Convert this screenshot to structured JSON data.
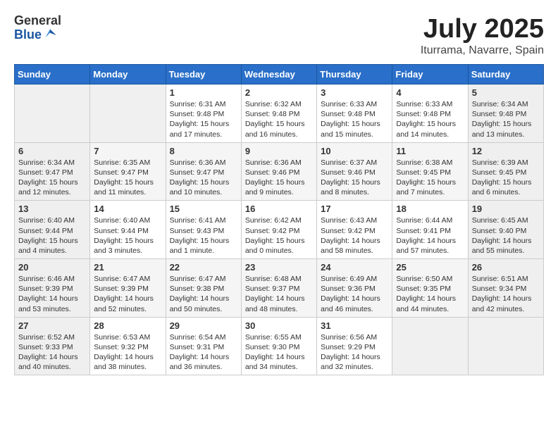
{
  "logo": {
    "general": "General",
    "blue": "Blue"
  },
  "title": "July 2025",
  "location": "Iturrama, Navarre, Spain",
  "weekdays": [
    "Sunday",
    "Monday",
    "Tuesday",
    "Wednesday",
    "Thursday",
    "Friday",
    "Saturday"
  ],
  "weeks": [
    [
      {
        "day": "",
        "info": ""
      },
      {
        "day": "",
        "info": ""
      },
      {
        "day": "1",
        "info": "Sunrise: 6:31 AM\nSunset: 9:48 PM\nDaylight: 15 hours and 17 minutes."
      },
      {
        "day": "2",
        "info": "Sunrise: 6:32 AM\nSunset: 9:48 PM\nDaylight: 15 hours and 16 minutes."
      },
      {
        "day": "3",
        "info": "Sunrise: 6:33 AM\nSunset: 9:48 PM\nDaylight: 15 hours and 15 minutes."
      },
      {
        "day": "4",
        "info": "Sunrise: 6:33 AM\nSunset: 9:48 PM\nDaylight: 15 hours and 14 minutes."
      },
      {
        "day": "5",
        "info": "Sunrise: 6:34 AM\nSunset: 9:48 PM\nDaylight: 15 hours and 13 minutes."
      }
    ],
    [
      {
        "day": "6",
        "info": "Sunrise: 6:34 AM\nSunset: 9:47 PM\nDaylight: 15 hours and 12 minutes."
      },
      {
        "day": "7",
        "info": "Sunrise: 6:35 AM\nSunset: 9:47 PM\nDaylight: 15 hours and 11 minutes."
      },
      {
        "day": "8",
        "info": "Sunrise: 6:36 AM\nSunset: 9:47 PM\nDaylight: 15 hours and 10 minutes."
      },
      {
        "day": "9",
        "info": "Sunrise: 6:36 AM\nSunset: 9:46 PM\nDaylight: 15 hours and 9 minutes."
      },
      {
        "day": "10",
        "info": "Sunrise: 6:37 AM\nSunset: 9:46 PM\nDaylight: 15 hours and 8 minutes."
      },
      {
        "day": "11",
        "info": "Sunrise: 6:38 AM\nSunset: 9:45 PM\nDaylight: 15 hours and 7 minutes."
      },
      {
        "day": "12",
        "info": "Sunrise: 6:39 AM\nSunset: 9:45 PM\nDaylight: 15 hours and 6 minutes."
      }
    ],
    [
      {
        "day": "13",
        "info": "Sunrise: 6:40 AM\nSunset: 9:44 PM\nDaylight: 15 hours and 4 minutes."
      },
      {
        "day": "14",
        "info": "Sunrise: 6:40 AM\nSunset: 9:44 PM\nDaylight: 15 hours and 3 minutes."
      },
      {
        "day": "15",
        "info": "Sunrise: 6:41 AM\nSunset: 9:43 PM\nDaylight: 15 hours and 1 minute."
      },
      {
        "day": "16",
        "info": "Sunrise: 6:42 AM\nSunset: 9:42 PM\nDaylight: 15 hours and 0 minutes."
      },
      {
        "day": "17",
        "info": "Sunrise: 6:43 AM\nSunset: 9:42 PM\nDaylight: 14 hours and 58 minutes."
      },
      {
        "day": "18",
        "info": "Sunrise: 6:44 AM\nSunset: 9:41 PM\nDaylight: 14 hours and 57 minutes."
      },
      {
        "day": "19",
        "info": "Sunrise: 6:45 AM\nSunset: 9:40 PM\nDaylight: 14 hours and 55 minutes."
      }
    ],
    [
      {
        "day": "20",
        "info": "Sunrise: 6:46 AM\nSunset: 9:39 PM\nDaylight: 14 hours and 53 minutes."
      },
      {
        "day": "21",
        "info": "Sunrise: 6:47 AM\nSunset: 9:39 PM\nDaylight: 14 hours and 52 minutes."
      },
      {
        "day": "22",
        "info": "Sunrise: 6:47 AM\nSunset: 9:38 PM\nDaylight: 14 hours and 50 minutes."
      },
      {
        "day": "23",
        "info": "Sunrise: 6:48 AM\nSunset: 9:37 PM\nDaylight: 14 hours and 48 minutes."
      },
      {
        "day": "24",
        "info": "Sunrise: 6:49 AM\nSunset: 9:36 PM\nDaylight: 14 hours and 46 minutes."
      },
      {
        "day": "25",
        "info": "Sunrise: 6:50 AM\nSunset: 9:35 PM\nDaylight: 14 hours and 44 minutes."
      },
      {
        "day": "26",
        "info": "Sunrise: 6:51 AM\nSunset: 9:34 PM\nDaylight: 14 hours and 42 minutes."
      }
    ],
    [
      {
        "day": "27",
        "info": "Sunrise: 6:52 AM\nSunset: 9:33 PM\nDaylight: 14 hours and 40 minutes."
      },
      {
        "day": "28",
        "info": "Sunrise: 6:53 AM\nSunset: 9:32 PM\nDaylight: 14 hours and 38 minutes."
      },
      {
        "day": "29",
        "info": "Sunrise: 6:54 AM\nSunset: 9:31 PM\nDaylight: 14 hours and 36 minutes."
      },
      {
        "day": "30",
        "info": "Sunrise: 6:55 AM\nSunset: 9:30 PM\nDaylight: 14 hours and 34 minutes."
      },
      {
        "day": "31",
        "info": "Sunrise: 6:56 AM\nSunset: 9:29 PM\nDaylight: 14 hours and 32 minutes."
      },
      {
        "day": "",
        "info": ""
      },
      {
        "day": "",
        "info": ""
      }
    ]
  ]
}
